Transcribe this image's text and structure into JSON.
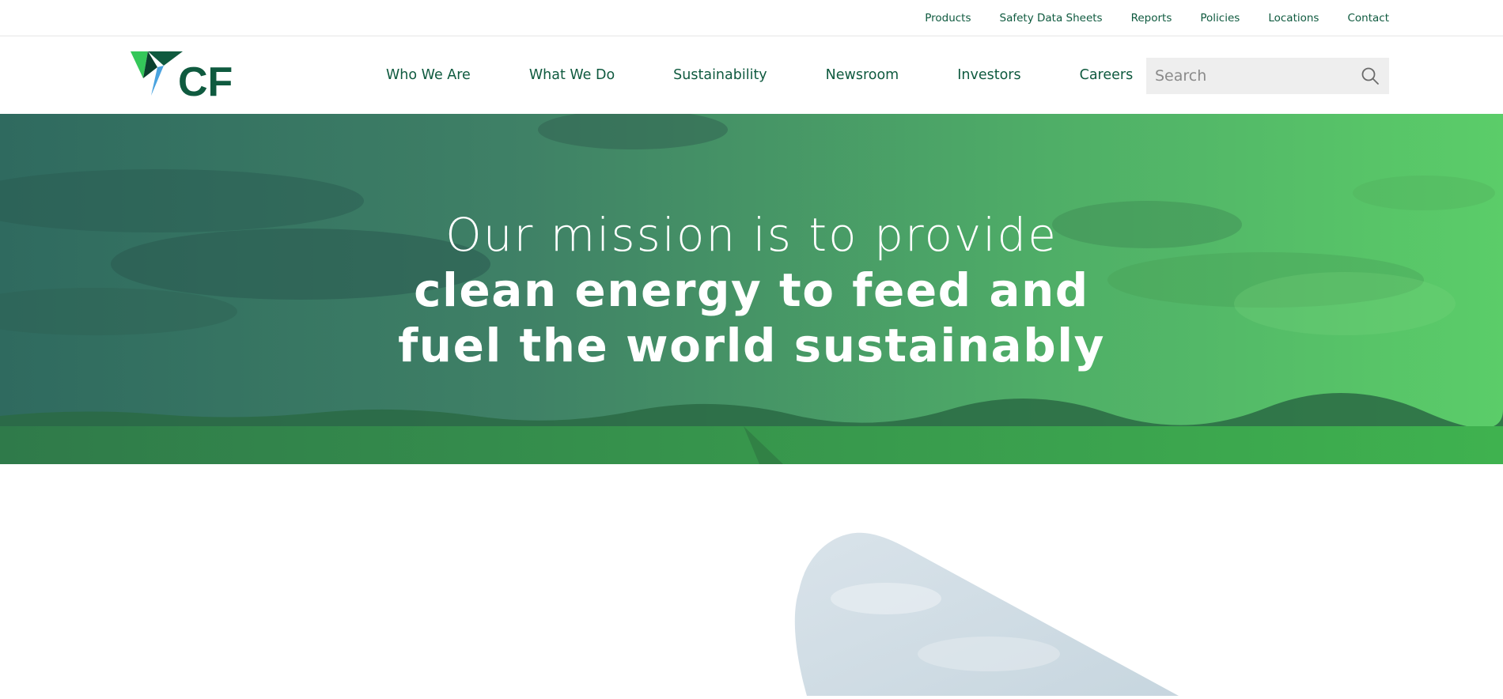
{
  "utility_nav": {
    "items": [
      "Products",
      "Safety Data Sheets",
      "Reports",
      "Policies",
      "Locations",
      "Contact"
    ]
  },
  "logo": {
    "text": "CF"
  },
  "primary_nav": {
    "items": [
      "Who We Are",
      "What We Do",
      "Sustainability",
      "Newsroom",
      "Investors",
      "Careers"
    ]
  },
  "search": {
    "placeholder": "Search"
  },
  "hero": {
    "line1": "Our mission is to provide",
    "line2": "clean energy to feed and",
    "line3": "fuel the world sustainably"
  },
  "colors": {
    "brand_green": "#0f5a3f",
    "hero_left": "#2f6a5f",
    "hero_right": "#55c566",
    "logo_light_green": "#34c759",
    "logo_blue": "#4aa3df"
  }
}
